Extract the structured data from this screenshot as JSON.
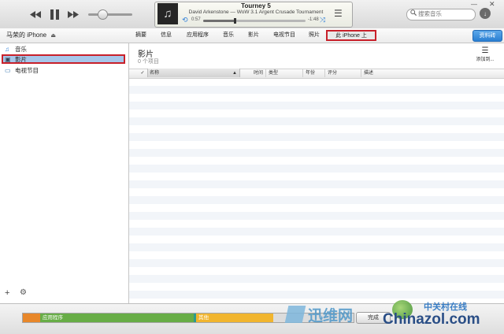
{
  "player": {
    "track_title": "Tourney 5",
    "track_subtitle": "David Arkenstone — WoW 3.1 Argent Crusade Tournament",
    "elapsed": "0:57",
    "remaining": "-1:48",
    "progress_fraction": 0.31,
    "volume_fraction": 0.3
  },
  "search": {
    "placeholder": "搜索音乐"
  },
  "nav": {
    "device_name": "马荣的 iPhone",
    "eject_symbol": "⏏",
    "tabs": [
      "摘要",
      "信息",
      "应用程序",
      "音乐",
      "影片",
      "电视节目",
      "照片",
      "此 iPhone 上"
    ],
    "selected_tab": "此 iPhone 上",
    "done_label": "资料砖"
  },
  "sidebar": {
    "items": [
      {
        "label": "音乐",
        "icon": "music-note-icon"
      },
      {
        "label": "影片",
        "icon": "film-icon",
        "selected": true
      },
      {
        "label": "电视节目",
        "icon": "tv-icon"
      }
    ]
  },
  "main": {
    "title": "影片",
    "count": "0 个项目",
    "add_to_label": "添加到...",
    "columns": [
      "名称",
      "时间",
      "类型",
      "年份",
      "评分",
      "描述"
    ],
    "sort_column": "名称",
    "check_mark": "✓"
  },
  "capacity": {
    "segments": [
      {
        "label": "",
        "color": "#e8872a"
      },
      {
        "label": "应用程序",
        "color": "#67ad46"
      },
      {
        "label": "",
        "color": "#2d9a8e"
      },
      {
        "label": "其他",
        "color": "#f1b52e"
      },
      {
        "label": "",
        "color": "#dcdcdc"
      }
    ],
    "sync_label": "完成"
  },
  "watermarks": {
    "left": "迅维网",
    "right_cn": "中关村在线",
    "right_en": "Chinazol.com"
  },
  "colors": {
    "selection_outline": "#c8202a",
    "selection_fill": "#a7c7ea",
    "accent_blue": "#2a7fd2"
  }
}
